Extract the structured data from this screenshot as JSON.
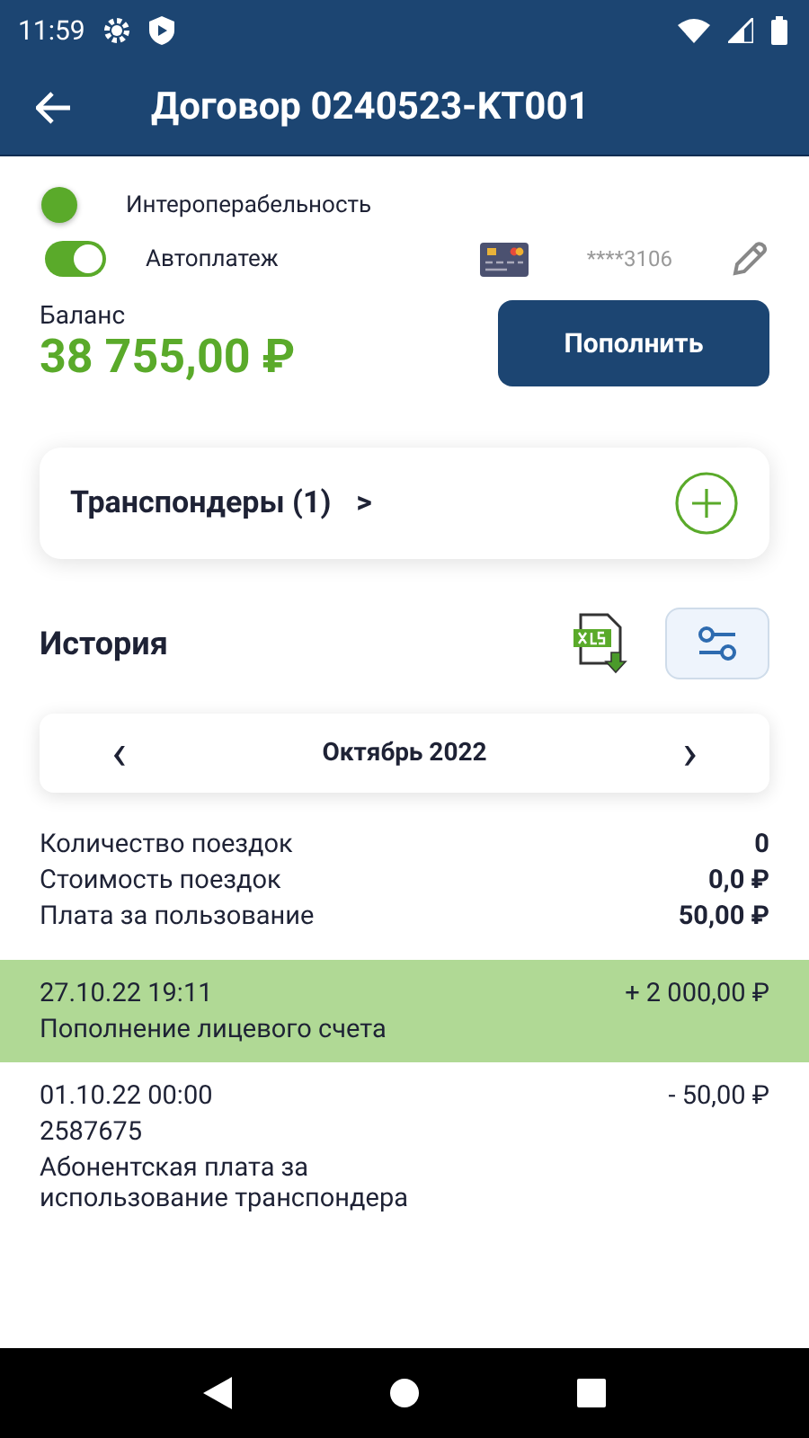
{
  "status_bar": {
    "time": "11:59"
  },
  "app_bar": {
    "title": "Договор 0240523-KT001"
  },
  "options": [
    {
      "kind": "dot",
      "label": "Интероперабельность",
      "on": true
    },
    {
      "kind": "switch",
      "label": "Автоплатеж",
      "on": true
    }
  ],
  "card": {
    "number": "****3106"
  },
  "balance": {
    "label": "Баланс",
    "amount": "38 755,00 ₽",
    "button": "Пополнить"
  },
  "transponders": {
    "label": "Транспондеры (1)",
    "chevron": ">"
  },
  "history": {
    "title": "История",
    "month": "Октябрь 2022",
    "prev": "‹",
    "next": "›"
  },
  "summary": [
    {
      "label": "Количество поездок",
      "value": "0"
    },
    {
      "label": "Стоимость поездок",
      "value": "0,0 ₽"
    },
    {
      "label": "Плата за пользование",
      "value": "50,00 ₽"
    }
  ],
  "transactions": [
    {
      "kind": "top_up",
      "date": "27.10.22 19:11",
      "amount": "+ 2 000,00 ₽",
      "lines": [
        "Пополнение лицевого счета"
      ]
    },
    {
      "kind": "charge",
      "date": "01.10.22 00:00",
      "amount": "- 50,00 ₽",
      "lines": [
        "2587675",
        "Абонентская плата за использование транспондера"
      ]
    }
  ]
}
